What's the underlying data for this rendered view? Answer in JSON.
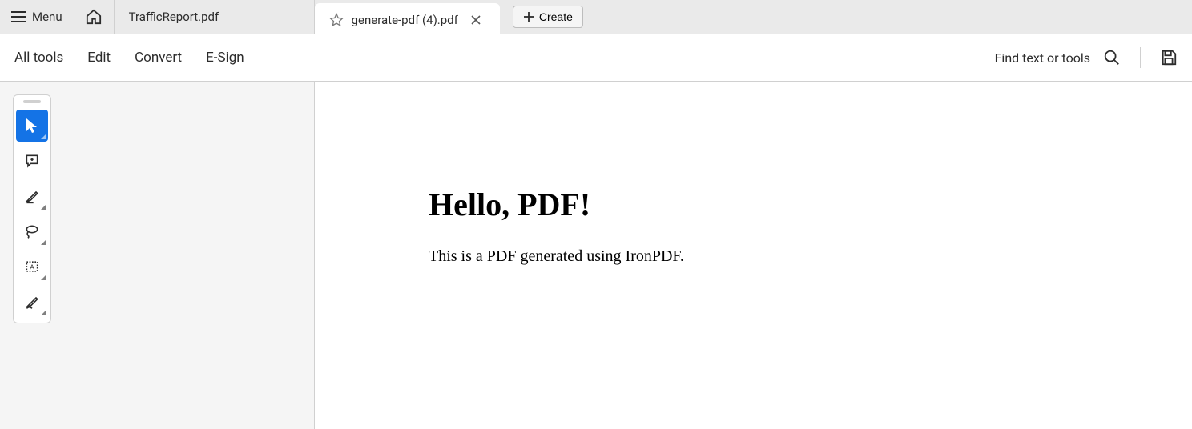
{
  "tabbar": {
    "menu_label": "Menu",
    "tabs": [
      {
        "label": "TrafficReport.pdf"
      },
      {
        "label": "generate-pdf (4).pdf"
      }
    ],
    "create_label": "Create"
  },
  "toolbar": {
    "items": [
      "All tools",
      "Edit",
      "Convert",
      "E-Sign"
    ],
    "find_label": "Find text or tools"
  },
  "document": {
    "heading": "Hello, PDF!",
    "body": "This is a PDF generated using IronPDF."
  },
  "tool_palette": {
    "tools": [
      {
        "name": "select-tool",
        "active": true
      },
      {
        "name": "comment-tool"
      },
      {
        "name": "highlight-tool"
      },
      {
        "name": "draw-tool"
      },
      {
        "name": "text-box-tool"
      },
      {
        "name": "sign-tool"
      }
    ]
  }
}
